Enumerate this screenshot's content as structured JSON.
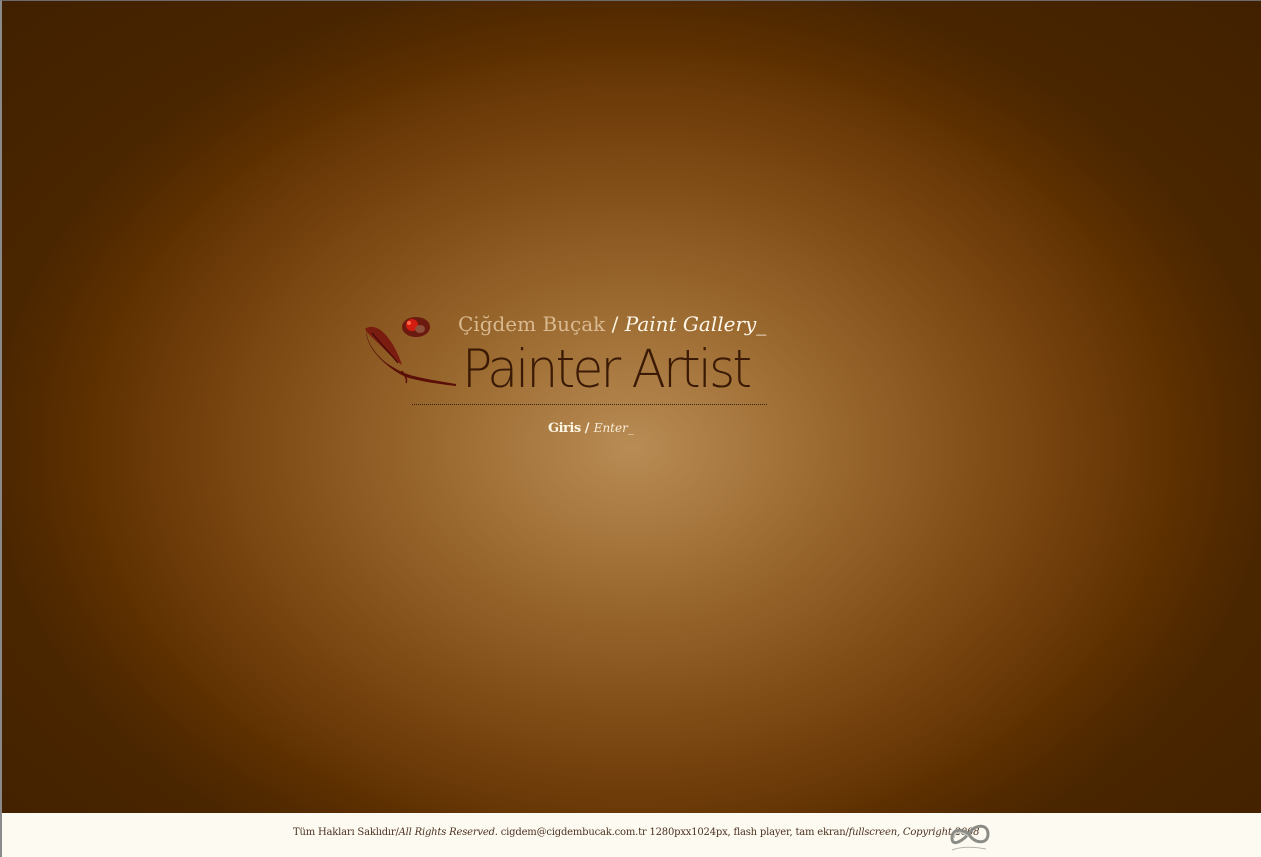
{
  "header": {
    "artist_name": "Çiğdem Buçak",
    "separator": "/",
    "gallery_label": "Paint Gallery_",
    "title": "Painter Artist"
  },
  "enter": {
    "label_tr": "Giris",
    "separator": "/",
    "label_en": "Enter_"
  },
  "footer": {
    "rights_tr": "Tüm Hakları Saklıdır/",
    "rights_en": "All Rights Reserved.",
    "email": "cigdem@cigdembucak.com.tr",
    "resolution": "1280pxx1024px, flash player, tam ekran/",
    "fullscreen": "fullscreen",
    "copyright": ", Copyright 2008"
  },
  "icons": {
    "logo": "paintbrush-feather-icon",
    "footer_mark": "infinity-logo-icon"
  },
  "colors": {
    "background_center": "#b98c55",
    "background_edge": "#5e3000",
    "title_text": "#3a1a04",
    "footer_bg": "#fdfaf1"
  }
}
